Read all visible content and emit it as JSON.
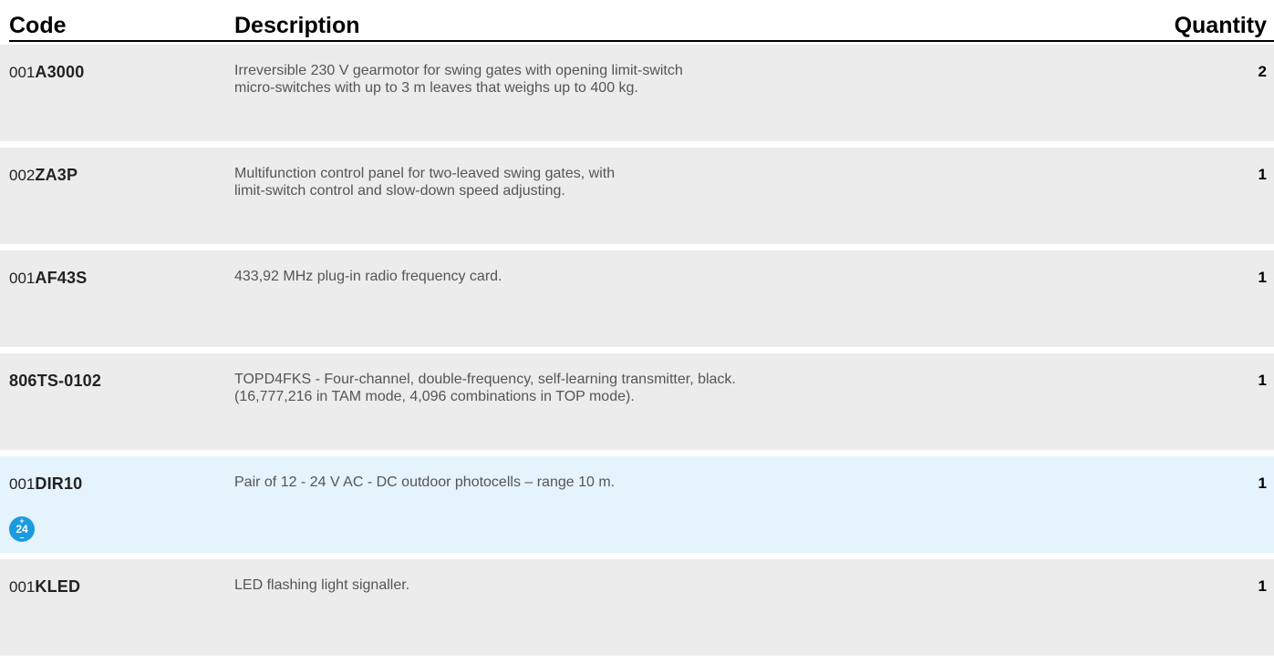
{
  "header": {
    "code": "Code",
    "description": "Description",
    "quantity": "Quantity"
  },
  "rows": [
    {
      "code_prefix": "001",
      "code_main": "A3000",
      "description": [
        "Irreversible 230 V gearmotor for swing gates with opening limit-switch",
        "micro-switches with up to 3 m leaves that weighs up to 400 kg."
      ],
      "quantity": "2"
    },
    {
      "code_prefix": "002",
      "code_main": "ZA3P",
      "description": [
        "Multifunction control panel for two-leaved swing gates, with",
        "limit-switch control and slow-down speed adjusting."
      ],
      "quantity": "1"
    },
    {
      "code_prefix": "001",
      "code_main": "AF43S",
      "description": [
        "433,92 MHz plug-in radio frequency card."
      ],
      "quantity": "1"
    },
    {
      "code_prefix": "",
      "code_main": "806TS-0102",
      "description": [
        "TOPD4FKS - Four-channel, double-frequency, self-learning transmitter, black.",
        "(16,777,216 in TAM mode, 4,096 combinations in TOP mode)."
      ],
      "quantity": "1"
    },
    {
      "code_prefix": "001",
      "code_main": "DIR10",
      "description": [
        "Pair of 12 - 24 V AC - DC  outdoor photocells – range 10 m."
      ],
      "quantity": "1",
      "highlight": true,
      "badge": {
        "plus": "+",
        "number": "24",
        "minus": "–",
        "icon": "voltage-24v-icon",
        "color": "#1a9be0"
      }
    },
    {
      "code_prefix": "001",
      "code_main": "KLED",
      "description": [
        "LED flashing light signaller."
      ],
      "quantity": "1"
    }
  ],
  "colors": {
    "row_bg": "#ececec",
    "row_highlight_bg": "#e5f3fc",
    "accent": "#1a9be0"
  }
}
